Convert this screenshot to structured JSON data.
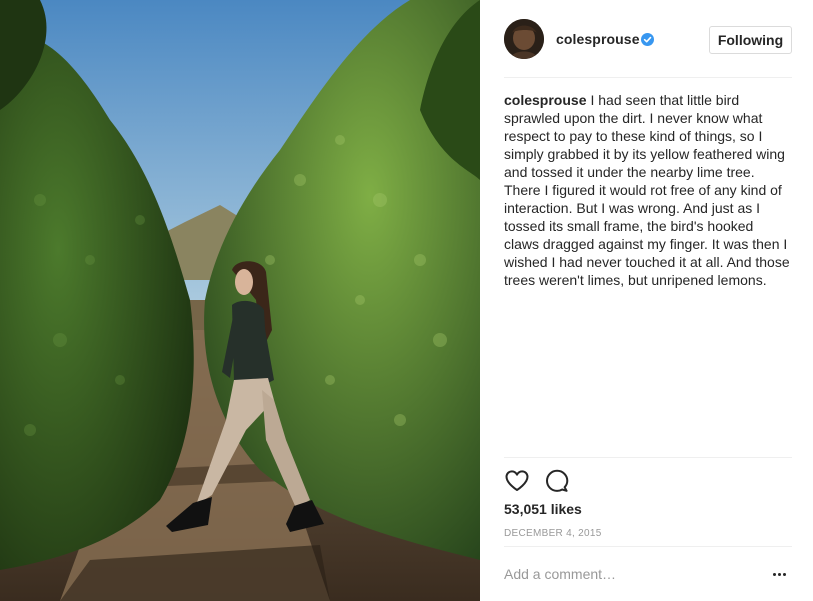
{
  "post": {
    "username": "colesprouse",
    "follow_label": "Following",
    "caption_text": "I had seen that little bird sprawled upon the dirt. I never know what respect to pay to these kind of things, so I simply grabbed it by its yellow feathered wing and tossed it under the nearby lime tree. There I figured it would rot free of any kind of interaction. But I was wrong. And just as I tossed its small frame, the bird's hooked claws dragged against my finger. It was then I wished I had never touched it at all. And those trees weren't limes, but unripened lemons.",
    "likes": "53,051 likes",
    "date": "DECEMBER 4, 2015",
    "comment_placeholder": "Add a comment…"
  },
  "icons": {
    "like": "heart-icon",
    "comment": "comment-bubble-icon",
    "verified": "verified-badge-icon",
    "more": "more-options-icon"
  },
  "colors": {
    "verified_blue": "#3897f0",
    "text": "#262626",
    "muted": "#999999",
    "border": "#dbdbdb"
  }
}
